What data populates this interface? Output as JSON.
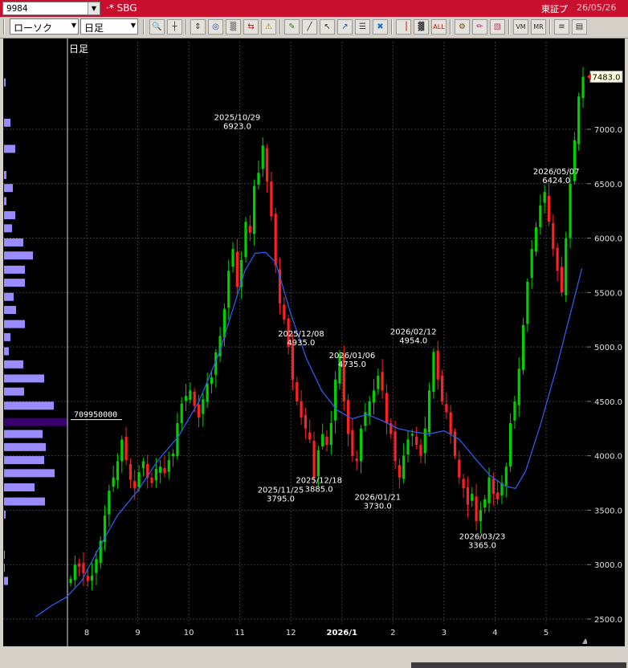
{
  "title_bar": {
    "stock_code": "9984",
    "name": "·* SBG",
    "market": "東証プ",
    "date": "26/05/26",
    "background": "#c8102e"
  },
  "toolbar": {
    "chart_style": "ローソク",
    "period": "日足",
    "buttons": [
      {
        "name": "zoom-icon",
        "glyph": "🔍"
      },
      {
        "name": "crosshair-icon",
        "glyph": "┼"
      },
      {
        "name": "scroll-icon",
        "glyph": "⇕"
      },
      {
        "name": "search-icon",
        "glyph": "◎"
      },
      {
        "name": "grid-icon",
        "glyph": "▒"
      },
      {
        "name": "split-icon",
        "glyph": "⇆"
      },
      {
        "name": "warning-icon",
        "glyph": "⚠"
      },
      {
        "name": "pencil-icon",
        "glyph": "✎"
      },
      {
        "name": "line-tool-icon",
        "glyph": "╱"
      },
      {
        "name": "pointer-icon",
        "glyph": "↖"
      },
      {
        "name": "arrow-tool-icon",
        "glyph": "↗"
      },
      {
        "name": "document-icon",
        "glyph": "☰"
      },
      {
        "name": "trash-icon",
        "glyph": "✖"
      },
      {
        "name": "candle-icon",
        "glyph": "▕"
      },
      {
        "name": "candle-all-icon",
        "glyph": "▓"
      },
      {
        "name": "all-icon",
        "glyph": "ALL"
      },
      {
        "name": "settings-icon",
        "glyph": "⚙"
      },
      {
        "name": "draw-icon",
        "glyph": "✏"
      },
      {
        "name": "color-icon",
        "glyph": "▧"
      },
      {
        "name": "window-vm-icon",
        "glyph": "VM"
      },
      {
        "name": "window-mr-icon",
        "glyph": "MR"
      },
      {
        "name": "list-icon",
        "glyph": "≡"
      },
      {
        "name": "layout-icon",
        "glyph": "▤"
      }
    ]
  },
  "colors": {
    "up": "#00d000",
    "down": "#ff2020",
    "ma": "#3060ff",
    "volume_profile": "#9a8cff",
    "volume_profile_peak": "#3a006e",
    "grid": "#3a3a3a",
    "text": "#ffffff",
    "last_price_bg": "#ffffe0"
  },
  "chart_data": {
    "type": "candlestick",
    "period_label": "日足",
    "y_range": [
      2300,
      7700
    ],
    "y_ticks": [
      2500,
      3000,
      3500,
      4000,
      4500,
      5000,
      5500,
      6000,
      6500,
      7000
    ],
    "y_tick_labels": [
      "2500.0",
      "3000.0",
      "3500.0",
      "4000.0",
      "4500.0",
      "5000.0",
      "5500.0",
      "6000.0",
      "6500.0",
      "7000.0"
    ],
    "last_price": "7483.0",
    "x_ticks": [
      {
        "label": "8",
        "month": 8
      },
      {
        "label": "9",
        "month": 9
      },
      {
        "label": "10",
        "month": 10
      },
      {
        "label": "11",
        "month": 11
      },
      {
        "label": "12",
        "month": 12
      },
      {
        "label": "2026/1",
        "month": 13
      },
      {
        "label": "2",
        "month": 14
      },
      {
        "label": "3",
        "month": 15
      },
      {
        "label": "4",
        "month": 16
      },
      {
        "label": "5",
        "month": 17
      }
    ],
    "closes": [
      2870,
      3000,
      2980,
      2920,
      2850,
      2900,
      3050,
      3220,
      3450,
      3680,
      3800,
      3950,
      4150,
      3960,
      3780,
      3700,
      3850,
      3950,
      3800,
      3750,
      3880,
      3900,
      3840,
      3960,
      4020,
      4300,
      4480,
      4550,
      4600,
      4460,
      4350,
      4520,
      4660,
      4720,
      4950,
      5100,
      5350,
      5700,
      5900,
      5550,
      5800,
      6150,
      6050,
      6480,
      6600,
      6850,
      6520,
      6200,
      5750,
      5400,
      5250,
      5000,
      4700,
      4500,
      4350,
      4250,
      4150,
      3800,
      4050,
      4200,
      4100,
      4300,
      4700,
      4935,
      4500,
      4200,
      4000,
      3950,
      4250,
      4400,
      4500,
      4600,
      4735,
      4600,
      4300,
      4200,
      3950,
      3800,
      4000,
      4150,
      4200,
      4100,
      4000,
      4250,
      4600,
      4954,
      4700,
      4500,
      4400,
      4200,
      4000,
      3800,
      3700,
      3550,
      3650,
      3400,
      3500,
      3600,
      3800,
      3650,
      3600,
      3750,
      3900,
      4300,
      4500,
      4800,
      5200,
      5600,
      5900,
      6100,
      6300,
      6424,
      6150,
      5900,
      5700,
      5500,
      6000,
      6500,
      6900,
      7300,
      7483
    ],
    "ma_label": "",
    "ma": [
      {
        "m": 7.0,
        "v": 2520
      },
      {
        "m": 7.3,
        "v": 2620
      },
      {
        "m": 7.6,
        "v": 2700
      },
      {
        "m": 7.9,
        "v": 2850
      },
      {
        "m": 8.2,
        "v": 3120
      },
      {
        "m": 8.6,
        "v": 3450
      },
      {
        "m": 9.0,
        "v": 3680
      },
      {
        "m": 9.4,
        "v": 3960
      },
      {
        "m": 9.8,
        "v": 4180
      },
      {
        "m": 10.2,
        "v": 4500
      },
      {
        "m": 10.6,
        "v": 4950
      },
      {
        "m": 10.9,
        "v": 5400
      },
      {
        "m": 11.1,
        "v": 5700
      },
      {
        "m": 11.3,
        "v": 5860
      },
      {
        "m": 11.5,
        "v": 5870
      },
      {
        "m": 11.7,
        "v": 5780
      },
      {
        "m": 12.0,
        "v": 5300
      },
      {
        "m": 12.3,
        "v": 4900
      },
      {
        "m": 12.6,
        "v": 4600
      },
      {
        "m": 12.9,
        "v": 4420
      },
      {
        "m": 13.2,
        "v": 4340
      },
      {
        "m": 13.5,
        "v": 4380
      },
      {
        "m": 13.8,
        "v": 4320
      },
      {
        "m": 14.1,
        "v": 4250
      },
      {
        "m": 14.4,
        "v": 4220
      },
      {
        "m": 14.7,
        "v": 4200
      },
      {
        "m": 15.0,
        "v": 4230
      },
      {
        "m": 15.3,
        "v": 4150
      },
      {
        "m": 15.6,
        "v": 3980
      },
      {
        "m": 15.9,
        "v": 3820
      },
      {
        "m": 16.2,
        "v": 3720
      },
      {
        "m": 16.4,
        "v": 3700
      },
      {
        "m": 16.6,
        "v": 3860
      },
      {
        "m": 16.9,
        "v": 4300
      },
      {
        "m": 17.2,
        "v": 4800
      },
      {
        "m": 17.5,
        "v": 5350
      },
      {
        "m": 17.7,
        "v": 5720
      }
    ],
    "annotations": [
      {
        "date": "2025/10/29",
        "price": "6923.0",
        "m": 10.95,
        "v": 6923,
        "pos": "above"
      },
      {
        "date": "2025/11/25",
        "price": "3795.0",
        "m": 11.8,
        "v": 3795,
        "pos": "below"
      },
      {
        "date": "2025/12/08",
        "price": "4935.0",
        "m": 12.2,
        "v": 4935,
        "pos": "above"
      },
      {
        "date": "2025/12/18",
        "price": "3885.0",
        "m": 12.55,
        "v": 3885,
        "pos": "below"
      },
      {
        "date": "2026/01/06",
        "price": "4735.0",
        "m": 13.2,
        "v": 4735,
        "pos": "above"
      },
      {
        "date": "2026/01/21",
        "price": "3730.0",
        "m": 13.7,
        "v": 3730,
        "pos": "below"
      },
      {
        "date": "2026/02/12",
        "price": "4954.0",
        "m": 14.4,
        "v": 4954,
        "pos": "above"
      },
      {
        "date": "2026/03/23",
        "price": "3365.0",
        "m": 15.75,
        "v": 3365,
        "pos": "below"
      },
      {
        "date": "2026/05/07",
        "price": "6424.0",
        "m": 17.2,
        "v": 6424,
        "pos": "above"
      }
    ],
    "volume_profile": {
      "label": "709950000",
      "peak_price": 4310,
      "bars": [
        {
          "p": 7430,
          "w": 2
        },
        {
          "p": 7060,
          "w": 8
        },
        {
          "p": 6820,
          "w": 14
        },
        {
          "p": 6580,
          "w": 3
        },
        {
          "p": 6460,
          "w": 11
        },
        {
          "p": 6340,
          "w": 3
        },
        {
          "p": 6210,
          "w": 14
        },
        {
          "p": 6090,
          "w": 10
        },
        {
          "p": 5960,
          "w": 24
        },
        {
          "p": 5840,
          "w": 36
        },
        {
          "p": 5710,
          "w": 26
        },
        {
          "p": 5590,
          "w": 26
        },
        {
          "p": 5460,
          "w": 12
        },
        {
          "p": 5340,
          "w": 15
        },
        {
          "p": 5210,
          "w": 26
        },
        {
          "p": 5090,
          "w": 8
        },
        {
          "p": 4960,
          "w": 6
        },
        {
          "p": 4840,
          "w": 24
        },
        {
          "p": 4710,
          "w": 50
        },
        {
          "p": 4590,
          "w": 25
        },
        {
          "p": 4460,
          "w": 62
        },
        {
          "p": 4310,
          "w": 78
        },
        {
          "p": 4200,
          "w": 48
        },
        {
          "p": 4080,
          "w": 52
        },
        {
          "p": 3960,
          "w": 50
        },
        {
          "p": 3840,
          "w": 63
        },
        {
          "p": 3710,
          "w": 38
        },
        {
          "p": 3580,
          "w": 51
        },
        {
          "p": 3460,
          "w": 2
        },
        {
          "p": 3090,
          "w": 1
        },
        {
          "p": 2970,
          "w": 1
        },
        {
          "p": 2850,
          "w": 5
        }
      ]
    }
  }
}
